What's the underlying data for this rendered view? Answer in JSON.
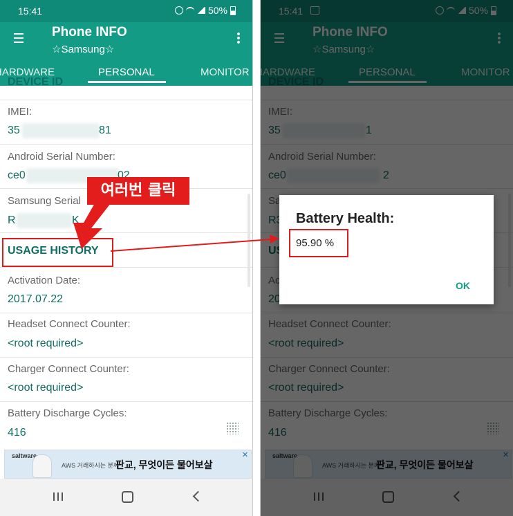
{
  "status_bar": {
    "time": "15:41",
    "battery": "50%"
  },
  "app_bar": {
    "title": "Phone INFO",
    "subtitle": "☆Samsung☆"
  },
  "tabs": [
    "HARDWARE",
    "PERSONAL",
    "MONITOR"
  ],
  "content": {
    "device_id_header": "DEVICE ID",
    "imei_label": "IMEI:",
    "imei_left_prefix": "35",
    "imei_left_suffix": "81",
    "imei_right_suffix": "1",
    "serial_label": "Android Serial Number:",
    "serial_prefix": "ce0",
    "serial_left_suffix": "02",
    "serial_right_suffix": "2",
    "samsung_serial_label": "Samsung Serial",
    "samsung_serial_prefix": "R",
    "samsung_serial_suffix": "K",
    "samsung_serial_label_right": "Sa",
    "samsung_serial_prefix_right": "R3",
    "usage_history": "USAGE HISTORY",
    "usage_history_right": "US",
    "activation_label": "Activation Date:",
    "activation_label_right": "Ac",
    "activation_value": "2017.07.22",
    "activation_value_right": "20",
    "headset_label": "Headset Connect Counter:",
    "headset_value": "<root required>",
    "charger_label": "Charger Connect Counter:",
    "charger_value": "<root required>",
    "discharge_label": "Battery Discharge Cycles:",
    "discharge_value": "416"
  },
  "ad": {
    "brand": "saltware",
    "small_text": "AWS 거래하시는 분께",
    "text": "판교, 무엇이든 물어보살",
    "close": "✕"
  },
  "annotation": {
    "callout": "여러번 클릭"
  },
  "dialog": {
    "title": "Battery Health:",
    "message": "95.90 %",
    "ok": "OK"
  }
}
